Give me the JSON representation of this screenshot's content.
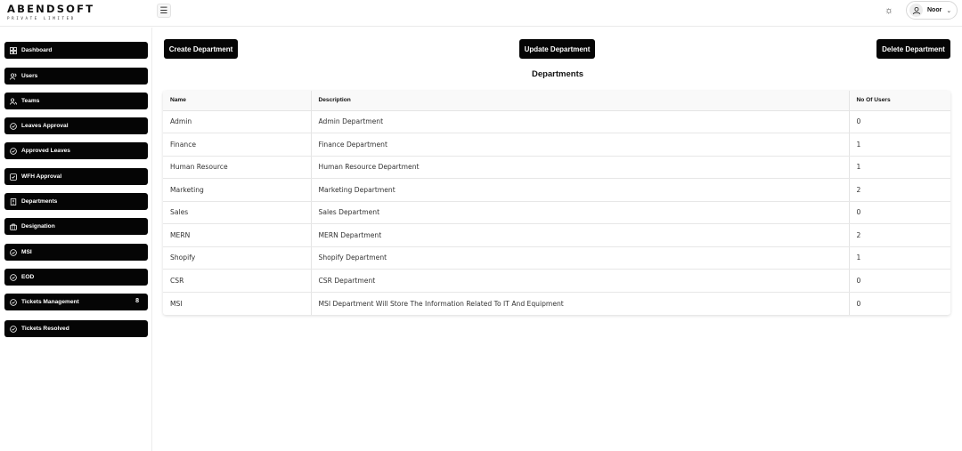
{
  "brand": {
    "name": "ABENDSOFT",
    "tagline": "PRIVATE LIMITED"
  },
  "header": {
    "user_name": "Noor"
  },
  "sidebar": {
    "items": [
      {
        "label": "Dashboard",
        "icon": "grid-icon"
      },
      {
        "label": "Users",
        "icon": "users-icon"
      },
      {
        "label": "Teams",
        "icon": "team-icon"
      },
      {
        "label": "Leaves Approval",
        "icon": "check-circle-icon"
      },
      {
        "label": "Approved Leaves",
        "icon": "check-circle-icon"
      },
      {
        "label": "WFH Approval",
        "icon": "check-square-icon"
      },
      {
        "label": "Departments",
        "icon": "building-icon"
      },
      {
        "label": "Designation",
        "icon": "briefcase-icon"
      },
      {
        "label": "MSI",
        "icon": "check-circle-icon"
      },
      {
        "label": "EOD",
        "icon": "check-circle-icon"
      },
      {
        "label": "Tickets Management",
        "icon": "check-circle-icon",
        "badge": "8"
      },
      {
        "label": "Tickets Resolved",
        "icon": "check-circle-icon"
      }
    ],
    "active": "Departments"
  },
  "toolbar": {
    "create_label": "Create Department",
    "update_label": "Update Department",
    "delete_label": "Delete Department"
  },
  "page": {
    "title": "Departments"
  },
  "table": {
    "columns": [
      "Name",
      "Description",
      "No Of Users"
    ],
    "rows": [
      {
        "name": "Admin",
        "description": "Admin Department",
        "users": "0"
      },
      {
        "name": "Finance",
        "description": "Finance Department",
        "users": "1"
      },
      {
        "name": "Human Resource",
        "description": "Human Resource Department",
        "users": "1"
      },
      {
        "name": "Marketing",
        "description": "Marketing Department",
        "users": "2"
      },
      {
        "name": "Sales",
        "description": "Sales Department",
        "users": "0"
      },
      {
        "name": "MERN",
        "description": "MERN Department",
        "users": "2"
      },
      {
        "name": "Shopify",
        "description": "Shopify Department",
        "users": "1"
      },
      {
        "name": "CSR",
        "description": "CSR Department",
        "users": "0"
      },
      {
        "name": "MSI",
        "description": "MSI Department Will Store The Information Related To IT And Equipment",
        "users": "0"
      }
    ]
  },
  "colors": {
    "accent": "#050505",
    "background": "#ffffff",
    "border": "#e4e4e4"
  }
}
